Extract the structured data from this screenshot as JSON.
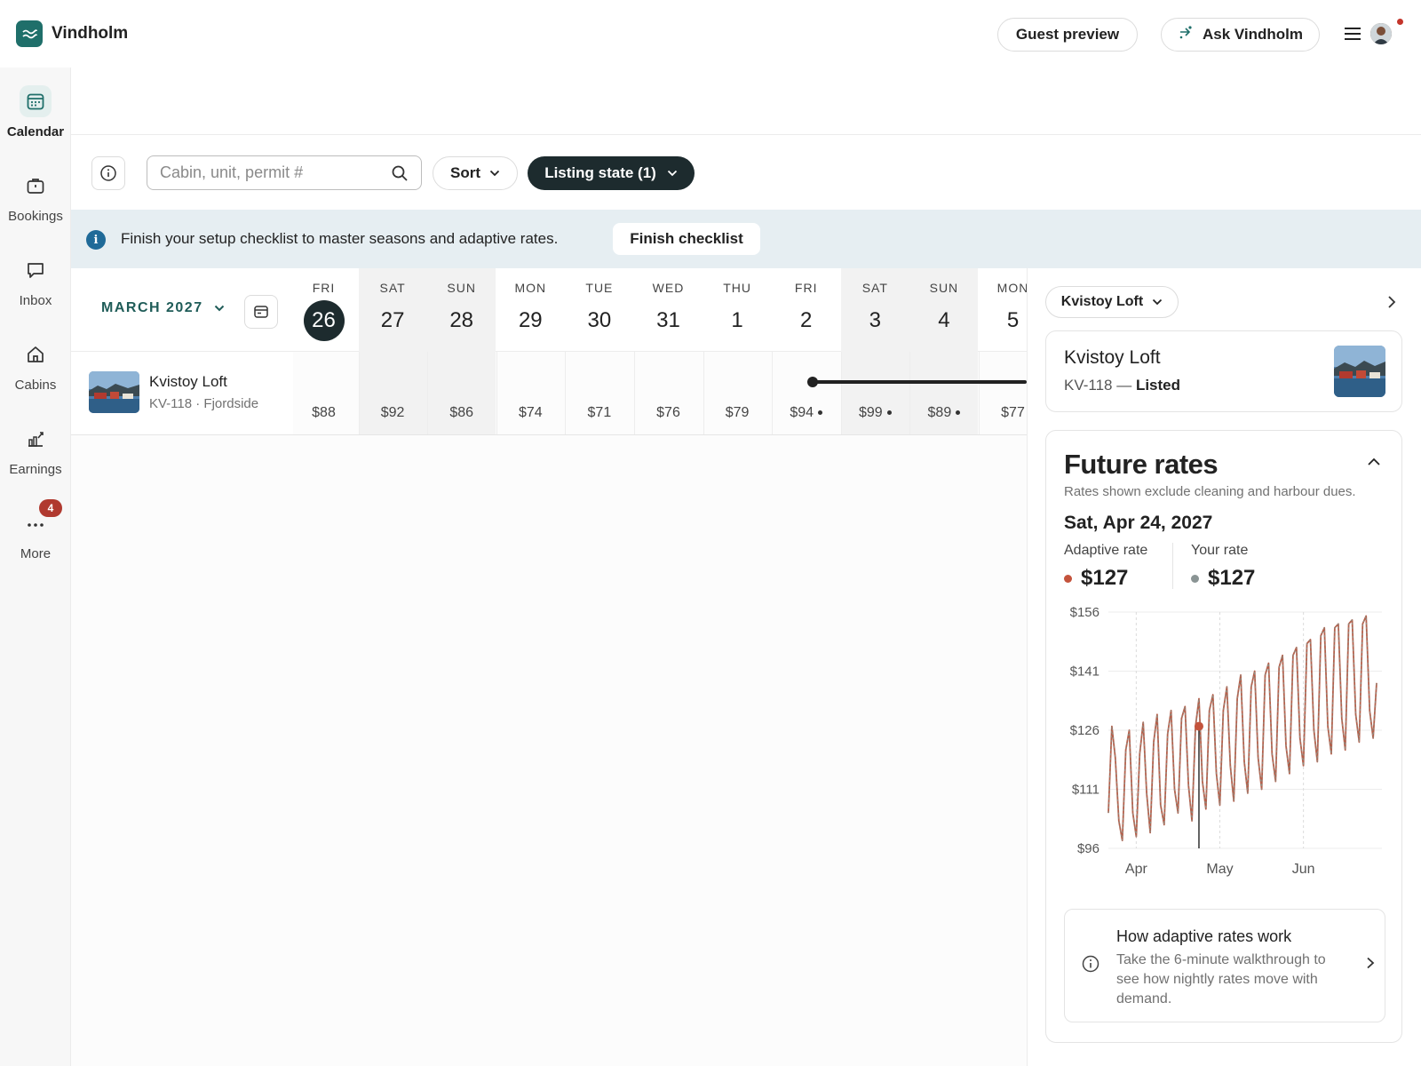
{
  "app": {
    "name": "Vindholm"
  },
  "header": {
    "guest_preview": "Guest preview",
    "ask": "Ask Vindholm"
  },
  "sidebar": {
    "items": [
      {
        "label": "Calendar",
        "icon": "calendar-icon",
        "active": true
      },
      {
        "label": "Bookings",
        "icon": "briefcase-icon"
      },
      {
        "label": "Inbox",
        "icon": "message-icon"
      },
      {
        "label": "Cabins",
        "icon": "home-icon"
      },
      {
        "label": "Earnings",
        "icon": "chart-icon"
      },
      {
        "label": "More",
        "icon": "more-icon",
        "badge": "4"
      }
    ]
  },
  "toolbar": {
    "search_placeholder": "Cabin, unit, permit #",
    "sort": "Sort",
    "listing_state": "Listing state (1)"
  },
  "banner": {
    "icon": "i",
    "text": "Finish your setup checklist to master seasons and adaptive rates.",
    "button": "Finish checklist"
  },
  "calendar": {
    "month": "MARCH 2027",
    "days": [
      {
        "name": "FRI",
        "num": "26",
        "price": "$88",
        "today": true
      },
      {
        "name": "SAT",
        "num": "27",
        "price": "$92",
        "weekend": true
      },
      {
        "name": "SUN",
        "num": "28",
        "price": "$86",
        "weekend": true
      },
      {
        "name": "MON",
        "num": "29",
        "price": "$74"
      },
      {
        "name": "TUE",
        "num": "30",
        "price": "$71"
      },
      {
        "name": "WED",
        "num": "31",
        "price": "$76"
      },
      {
        "name": "THU",
        "num": "1",
        "price": "$79"
      },
      {
        "name": "FRI",
        "num": "2",
        "price": "$94",
        "dot": true
      },
      {
        "name": "SAT",
        "num": "3",
        "price": "$99",
        "dot": true,
        "weekend": true
      },
      {
        "name": "SUN",
        "num": "4",
        "price": "$89",
        "dot": true,
        "weekend": true
      },
      {
        "name": "MON",
        "num": "5",
        "price": "$77"
      }
    ],
    "listing": {
      "name": "Kvistoy Loft",
      "sub": "KV-118 · Fjordside"
    }
  },
  "panel": {
    "select": "Kvistoy Loft",
    "card": {
      "title": "Kvistoy Loft",
      "code": "KV-118 — ",
      "status": "Listed"
    },
    "future_rates": {
      "title": "Future rates",
      "note": "Rates shown exclude cleaning and harbour dues.",
      "date": "Sat, Apr 24, 2027",
      "adaptive_label": "Adaptive rate",
      "adaptive_value": "$127",
      "your_label": "Your rate",
      "your_value": "$127",
      "adaptive_color": "#c4533c",
      "your_color": "#8a9494"
    },
    "how": {
      "title": "How adaptive rates work",
      "text": "Take the 6-minute walkthrough to see how nightly rates move with demand."
    }
  },
  "chart_data": {
    "type": "line",
    "title": "",
    "xlabel": "",
    "ylabel": "",
    "ylim": [
      96,
      156
    ],
    "yticks": [
      "$156",
      "$141",
      "$126",
      "$111",
      "$96"
    ],
    "ytick_values": [
      156,
      141,
      126,
      111,
      96
    ],
    "xticks": [
      "Apr",
      "May",
      "Jun"
    ],
    "xtick_days": [
      8,
      32,
      56
    ],
    "selected_day": 26,
    "selected_value": 127,
    "series": [
      {
        "values": [
          105,
          127,
          119,
          103,
          98,
          121,
          126,
          105,
          99,
          120,
          128,
          110,
          100,
          123,
          130,
          107,
          102,
          125,
          131,
          111,
          105,
          129,
          132,
          112,
          103,
          127,
          134,
          113,
          106,
          131,
          135,
          115,
          107,
          131,
          137,
          117,
          108,
          134,
          140,
          118,
          110,
          137,
          141,
          119,
          111,
          140,
          143,
          120,
          113,
          142,
          145,
          122,
          115,
          145,
          147,
          124,
          117,
          148,
          149,
          126,
          118,
          150,
          152,
          127,
          120,
          152,
          153,
          129,
          121,
          153,
          154,
          130,
          123,
          153,
          155,
          131,
          124,
          138
        ]
      }
    ]
  }
}
